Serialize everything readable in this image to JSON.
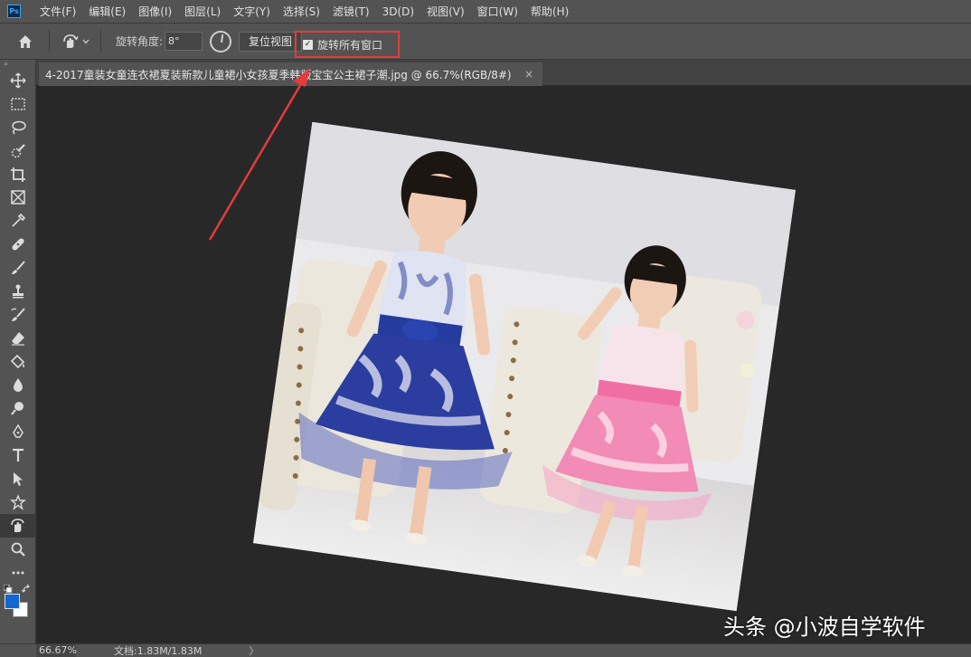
{
  "app": {
    "logo": "Ps"
  },
  "menu": [
    "文件(F)",
    "编辑(E)",
    "图像(I)",
    "图层(L)",
    "文字(Y)",
    "选择(S)",
    "滤镜(T)",
    "3D(D)",
    "视图(V)",
    "窗口(W)",
    "帮助(H)"
  ],
  "options": {
    "angle_label": "旋转角度:",
    "angle_value": "8°",
    "reset_view": "复位视图",
    "rotate_all_windows": "旋转所有窗口",
    "rotate_all_checked": true
  },
  "document": {
    "tab_title": "4-2017童装女童连衣裙夏装新款儿童裙小女孩夏季韩版宝宝公主裙子潮.jpg @ 66.7%(RGB/8#)",
    "close_glyph": "×"
  },
  "toolbar": {
    "tools": [
      "move-tool",
      "marquee-tool",
      "lasso-tool",
      "quick-select-tool",
      "crop-tool",
      "frame-tool",
      "eyedropper-tool",
      "healing-brush-tool",
      "brush-tool",
      "clone-stamp-tool",
      "history-brush-tool",
      "eraser-tool",
      "paint-bucket-tool",
      "blur-tool",
      "dodge-tool",
      "pen-tool",
      "type-tool",
      "path-select-tool",
      "custom-shape-tool",
      "rotate-view-tool",
      "zoom-tool",
      "more-tools"
    ],
    "active_tool": "rotate-view-tool",
    "foreground_color": "#1268d3",
    "background_color": "#ffffff"
  },
  "status": {
    "zoom": "66.67%",
    "doc_info": "文档:1.83M/1.83M",
    "arrow": "〉"
  },
  "watermark": "头条 @小波自学软件",
  "colors": {
    "highlight": "#e43b3b"
  }
}
